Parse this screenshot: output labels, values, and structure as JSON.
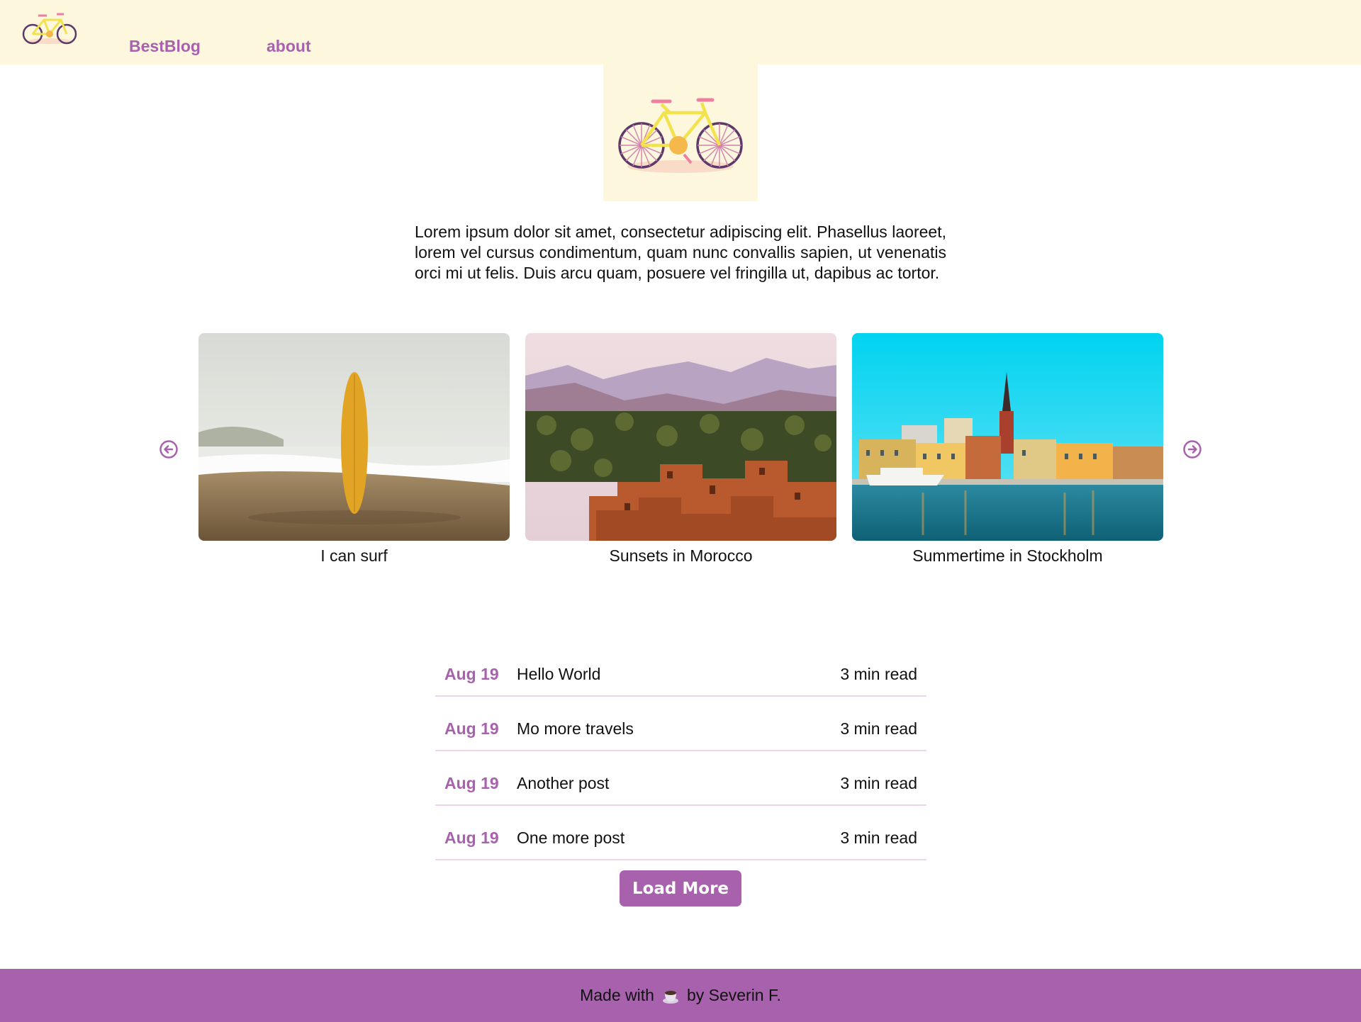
{
  "nav": {
    "logo_icon": "bicycle-icon",
    "brand": "BestBlog",
    "about": "about"
  },
  "hero": {
    "icon": "bicycle-icon"
  },
  "intro": "Lorem ipsum dolor sit amet, consectetur adipiscing elit. Phasellus laoreet, lorem vel cursus condimentum, quam nunc convallis sapien, ut venenatis orci mi ut felis. Duis arcu quam, posuere vel fringilla ut, dapibus ac tortor.",
  "carousel": {
    "prev_icon": "arrow-left-circle-icon",
    "next_icon": "arrow-right-circle-icon",
    "cards": [
      {
        "title": "I can surf",
        "image": "surfboard-beach"
      },
      {
        "title": "Sunsets in Morocco",
        "image": "morocco-village-mountains"
      },
      {
        "title": "Summertime in Stockholm",
        "image": "stockholm-waterfront"
      }
    ]
  },
  "posts": [
    {
      "date": "Aug 19",
      "title": "Hello World",
      "read": "3 min read"
    },
    {
      "date": "Aug 19",
      "title": "Mo more travels",
      "read": "3 min read"
    },
    {
      "date": "Aug 19",
      "title": "Another post",
      "read": "3 min read"
    },
    {
      "date": "Aug 19",
      "title": "One more post",
      "read": "3 min read"
    }
  ],
  "load_more": "Load More",
  "footer": {
    "prefix": "Made with",
    "icon": "coffee-cup-icon",
    "suffix": "by Severin F."
  },
  "colors": {
    "accent": "#a862ad",
    "header_bg": "#fdf7dd",
    "divider": "#ecd6ec"
  }
}
